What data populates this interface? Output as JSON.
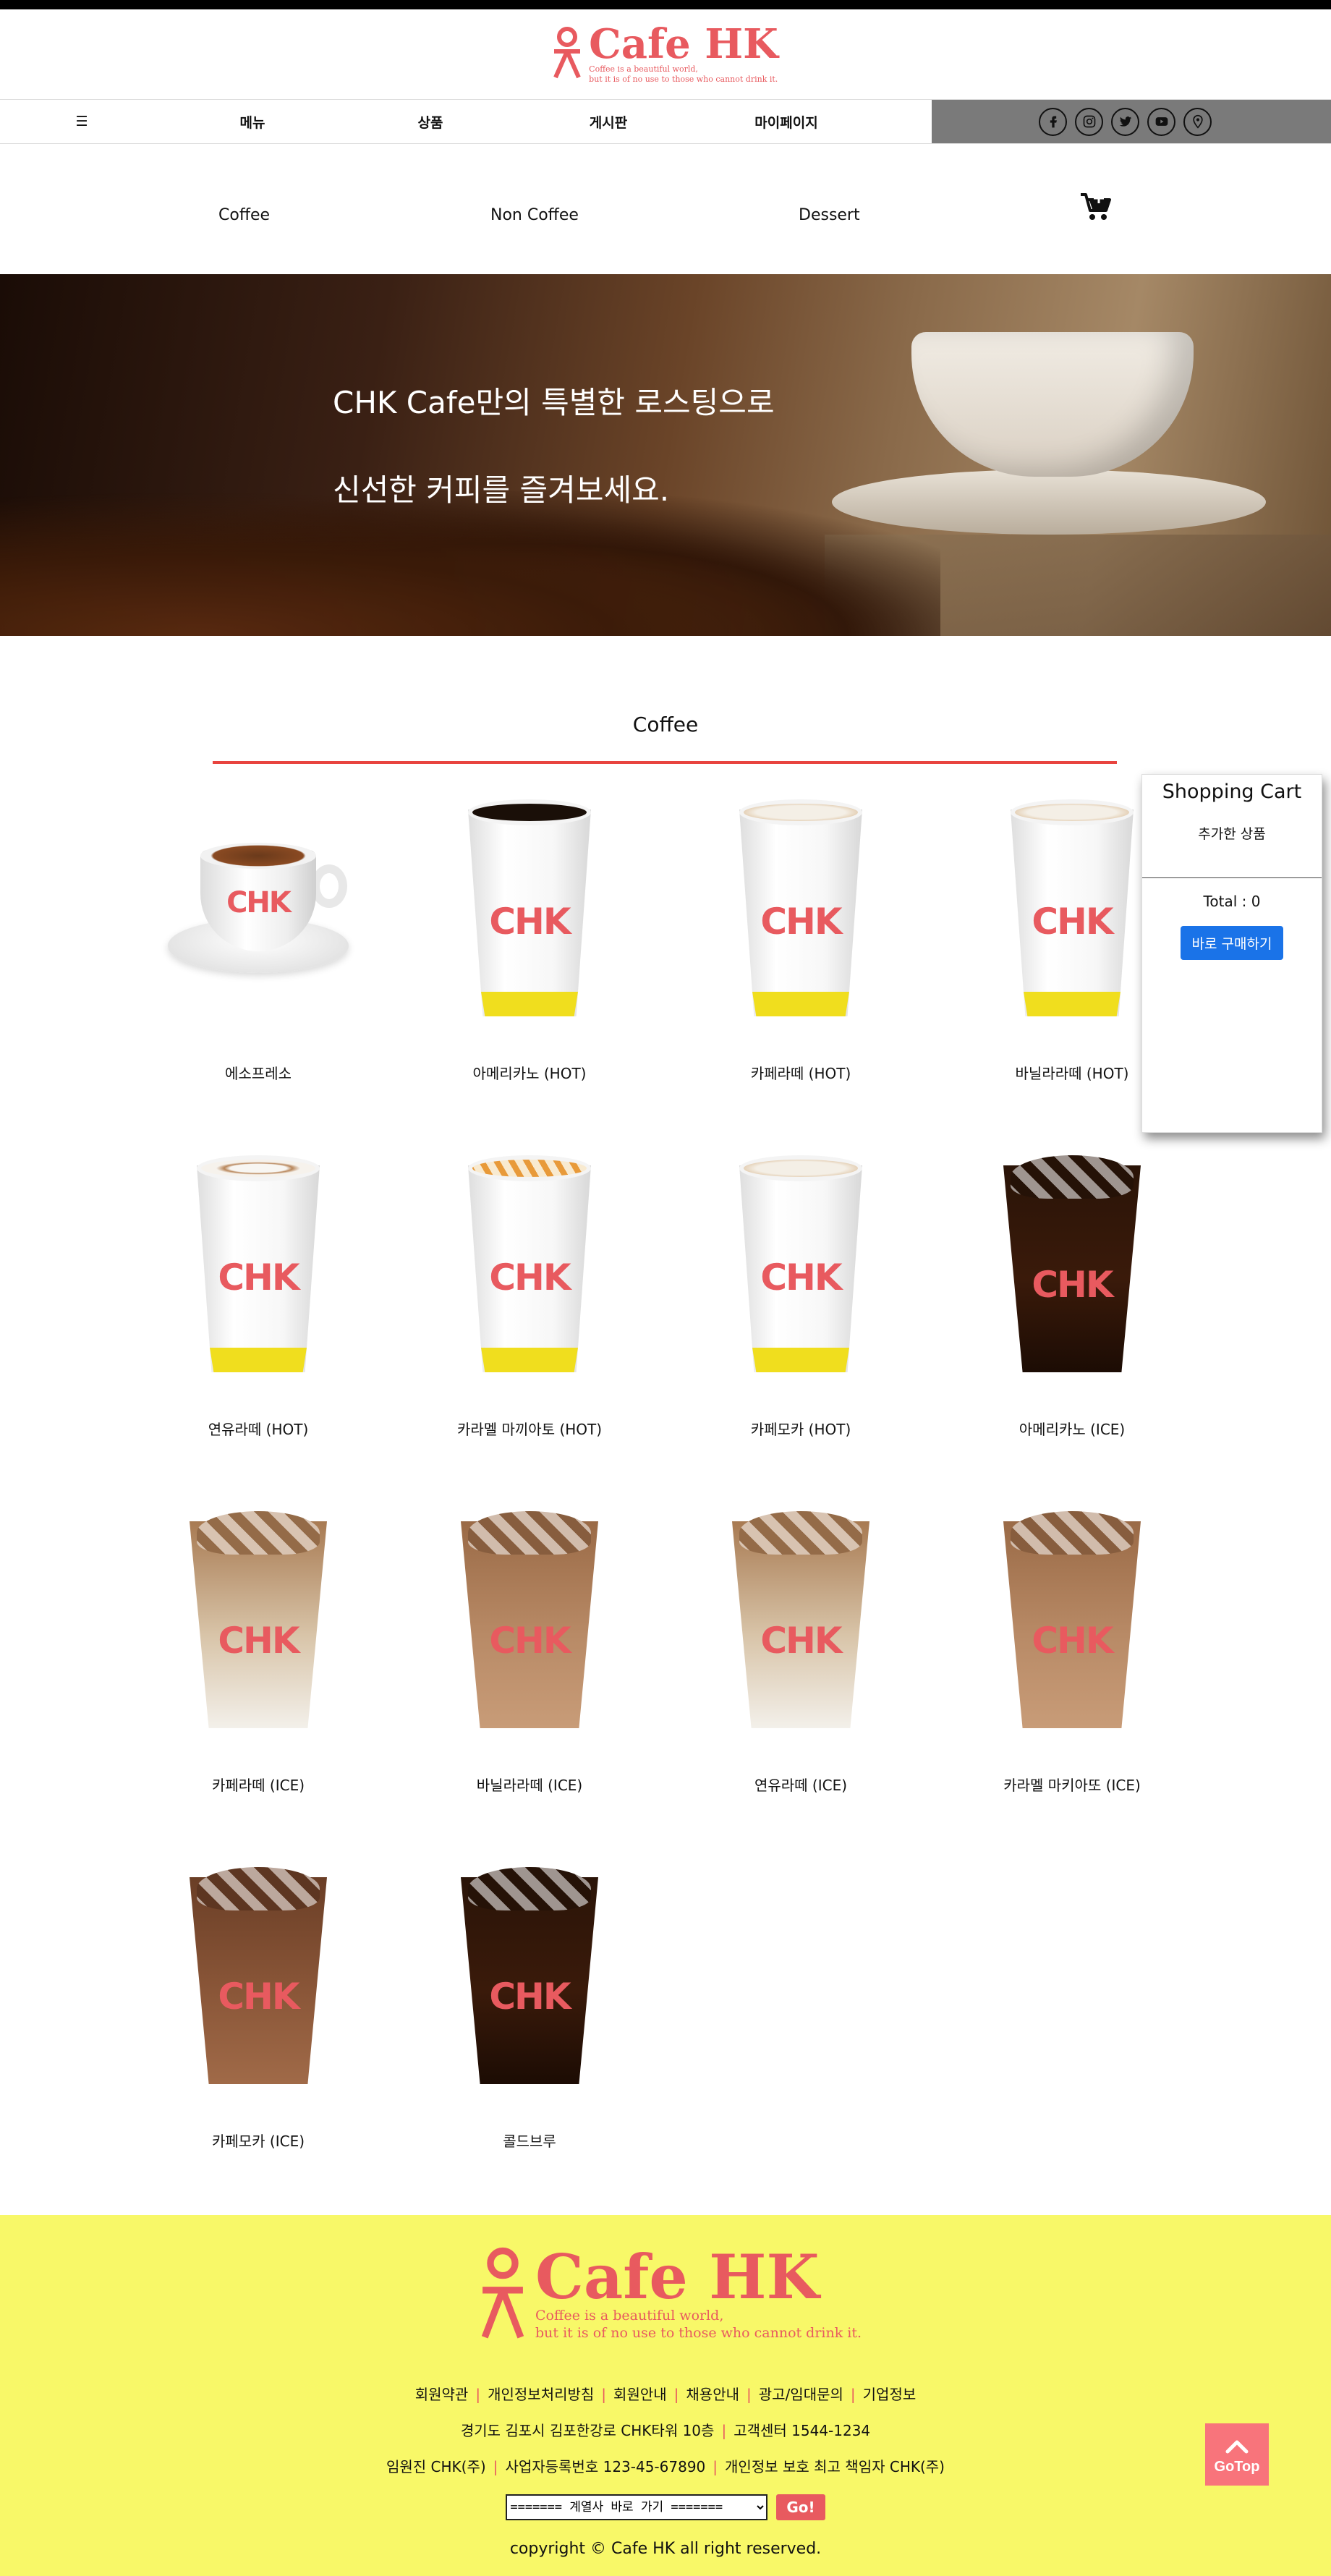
{
  "brand": {
    "name": "Cafe HK",
    "tagline_1": "Coffee is a beautiful world,",
    "tagline_2": "but it is of no use to those who cannot drink it."
  },
  "nav": {
    "hamburger": "☰",
    "items": [
      {
        "label": "메뉴"
      },
      {
        "label": "상품"
      },
      {
        "label": "게시판"
      },
      {
        "label": "마이페이지"
      }
    ]
  },
  "social": [
    "facebook-icon",
    "instagram-icon",
    "twitter-icon",
    "youtube-icon",
    "location-icon"
  ],
  "subnav": {
    "items": [
      {
        "label": "Coffee"
      },
      {
        "label": "Non Coffee"
      },
      {
        "label": "Dessert"
      }
    ]
  },
  "banner": {
    "line_1": "CHK Cafe만의 특별한 로스팅으로",
    "line_2": "신선한 커피를 즐겨보세요."
  },
  "section": {
    "title": "Coffee"
  },
  "product_brand": "CHK",
  "products": [
    {
      "name": "에소프레소",
      "kind": "espresso"
    },
    {
      "name": "아메리카노 (HOT)",
      "kind": "hot-dark"
    },
    {
      "name": "카페라떼 (HOT)",
      "kind": "hot-latte"
    },
    {
      "name": "바닐라라떼 (HOT)",
      "kind": "hot-latte"
    },
    {
      "name": "연유라떼 (HOT)",
      "kind": "hot-milk"
    },
    {
      "name": "카라멜 마끼아토 (HOT)",
      "kind": "hot-caramel"
    },
    {
      "name": "카페모카 (HOT)",
      "kind": "hot-latte"
    },
    {
      "name": "아메리카노 (ICE)",
      "kind": "ice-dark"
    },
    {
      "name": "카페라떼 (ICE)",
      "kind": "ice-latte"
    },
    {
      "name": "바닐라라떼 (ICE)",
      "kind": "ice-brown"
    },
    {
      "name": "연유라떼 (ICE)",
      "kind": "ice-latte"
    },
    {
      "name": "카라멜 마키아또 (ICE)",
      "kind": "ice-brown"
    },
    {
      "name": "카페모카 (ICE)",
      "kind": "ice-mocha"
    },
    {
      "name": "콜드브루",
      "kind": "ice-dark"
    }
  ],
  "cart": {
    "title": "Shopping Cart",
    "subtitle": "추가한 상품",
    "total": "Total : 0",
    "buy_label": "바로 구매하기"
  },
  "footer": {
    "links": [
      "회원약관",
      "개인정보처리방침",
      "회원안내",
      "채용안내",
      "광고/임대문의",
      "기업정보"
    ],
    "address": "경기도 김포시 김포한강로 CHK타워 10층",
    "phone": "고객센터 1544-1234",
    "ceo": "임원진 CHK(주)",
    "bizno": "사업자등록번호 123-45-67890",
    "privacy": "개인정보 보호 최고 책임자 CHK(주)",
    "select_value": "======= 계열사 바로 가기 =======",
    "go_label": "Go!",
    "copyright": "copyright © Cafe HK all right reserved."
  },
  "gotop": {
    "label": "GoTop"
  },
  "colors": {
    "accent": "#e85a5f",
    "footer_bg": "#f8f868",
    "nav_right_bg": "#7a7a7a",
    "rule": "#e8443f",
    "buy_button": "#1a73e8",
    "cup_band": "#f0de1e"
  }
}
